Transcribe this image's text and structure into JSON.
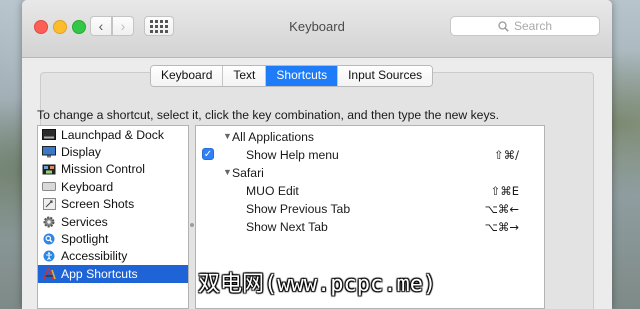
{
  "window": {
    "title": "Keyboard",
    "search_placeholder": "Search"
  },
  "tabs": [
    {
      "label": "Keyboard",
      "active": false
    },
    {
      "label": "Text",
      "active": false
    },
    {
      "label": "Shortcuts",
      "active": true
    },
    {
      "label": "Input Sources",
      "active": false
    }
  ],
  "instructions": "To change a shortcut, select it, click the key combination, and then type the new keys.",
  "categories": [
    {
      "label": "Launchpad & Dock",
      "icon": "launchpad-dock-icon"
    },
    {
      "label": "Display",
      "icon": "display-icon"
    },
    {
      "label": "Mission Control",
      "icon": "mission-control-icon"
    },
    {
      "label": "Keyboard",
      "icon": "keyboard-icon"
    },
    {
      "label": "Screen Shots",
      "icon": "screenshot-icon"
    },
    {
      "label": "Services",
      "icon": "gear-icon"
    },
    {
      "label": "Spotlight",
      "icon": "spotlight-icon"
    },
    {
      "label": "Accessibility",
      "icon": "accessibility-icon"
    },
    {
      "label": "App Shortcuts",
      "icon": "app-shortcuts-icon",
      "selected": true
    }
  ],
  "shortcuts": {
    "group_all": "All Applications",
    "show_help": {
      "label": "Show Help menu",
      "keys": "⇧⌘/",
      "checked": true
    },
    "group_safari": "Safari",
    "muo_edit": {
      "label": "MUO Edit",
      "keys": "⇧⌘E"
    },
    "prev_tab": {
      "label": "Show Previous Tab",
      "keys": "⌥⌘←"
    },
    "next_tab": {
      "label": "Show Next Tab",
      "keys": "⌥⌘→"
    }
  },
  "watermark": "双电网(www.pcpc.me)",
  "colors": {
    "selection": "#1e64d6",
    "active_tab": "#1e7cf8",
    "close": "#fc5f57",
    "minimize": "#fdbc2e",
    "zoom": "#33c748"
  }
}
